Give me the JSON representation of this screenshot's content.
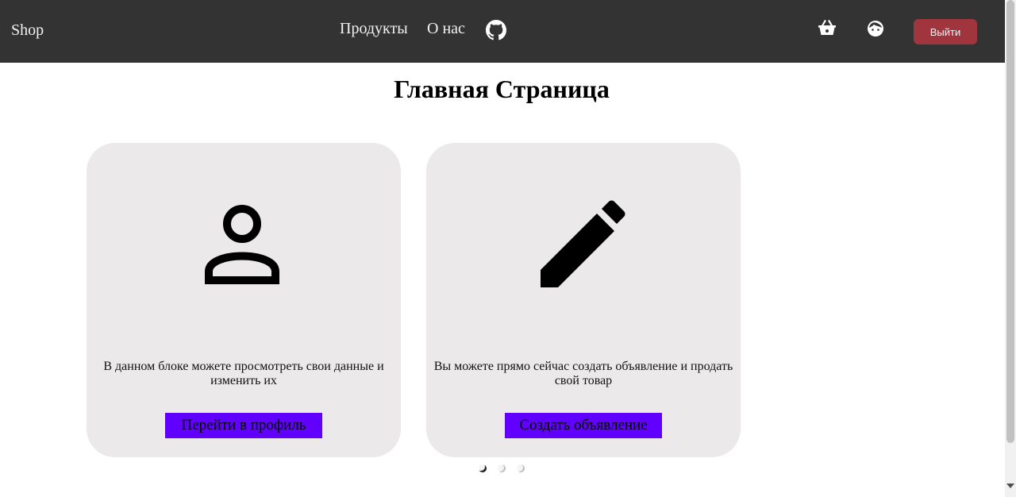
{
  "navbar": {
    "brand": "Shop",
    "links": [
      {
        "label": "Продукты"
      },
      {
        "label": "О нас"
      }
    ],
    "github_icon": "github-icon",
    "basket_icon": "shopping-basket-icon",
    "profile_icon": "face-icon",
    "logout_label": "Выйти",
    "colors": {
      "background": "#333333",
      "logout_button": "#a0353e"
    }
  },
  "main": {
    "title": "Главная Страница",
    "cards": [
      {
        "icon": "person-icon",
        "text": "В данном блоке можете просмотреть свои данные и изменить их",
        "button_label": "Перейти в профиль"
      },
      {
        "icon": "pencil-icon",
        "text": "Вы можете прямо сейчас создать объявление и продать свой товар",
        "button_label": "Создать объявление"
      }
    ],
    "button_color": "#6200ff",
    "card_color": "#ebe9ea"
  },
  "carousel": {
    "active_index": 0
  }
}
